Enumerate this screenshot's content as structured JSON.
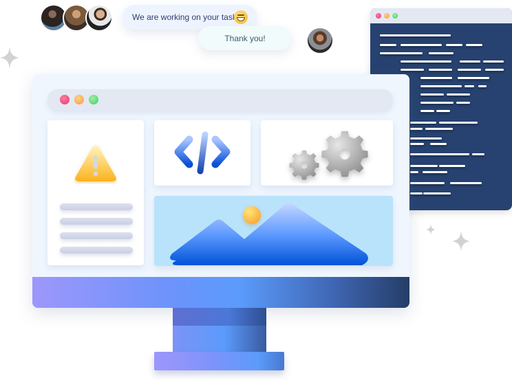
{
  "chat": {
    "team_avatars": [
      "team-member-1",
      "team-member-2",
      "team-member-3"
    ],
    "message_incoming": "We are working on your tasks",
    "message_incoming_emoji": "grinning-face",
    "message_reply": "Thank you!",
    "reply_avatar": "client"
  },
  "code_window": {
    "traffic_lights": [
      "#e23a6a",
      "#f59a3a",
      "#3ccf5a"
    ],
    "background": "#274270"
  },
  "monitor": {
    "traffic_lights": [
      "#e23a6a",
      "#f59a3a",
      "#3ccf5a"
    ],
    "cards": [
      {
        "icon": "warning-icon",
        "text_lines": 4
      },
      {
        "icon": "code-icon"
      },
      {
        "icon": "gears-icon"
      },
      {
        "icon": "image-icon"
      }
    ],
    "chin_gradient": [
      "#9d97fb",
      "#5b9bfb",
      "#253d67"
    ]
  },
  "decorations": [
    "sparkle",
    "sparkle",
    "sparkle"
  ]
}
